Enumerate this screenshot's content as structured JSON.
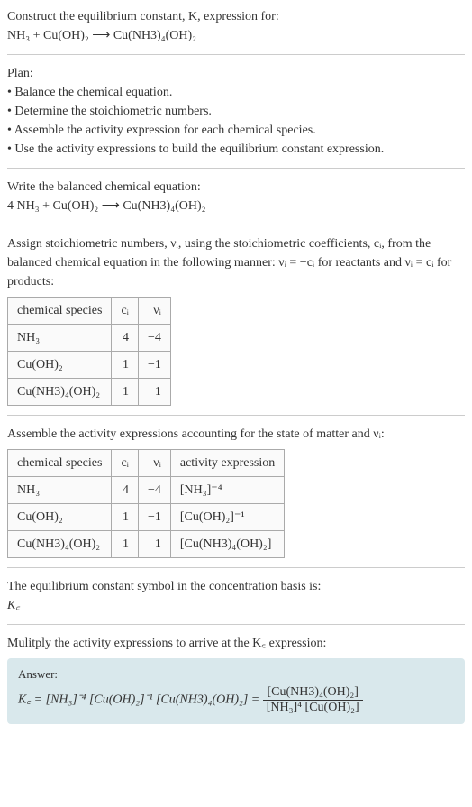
{
  "intro": {
    "line1": "Construct the equilibrium constant, K, expression for:",
    "equation": "NH₃ + Cu(OH)₂ ⟶ Cu(NH3)₄(OH)₂"
  },
  "plan": {
    "heading": "Plan:",
    "items": [
      "• Balance the chemical equation.",
      "• Determine the stoichiometric numbers.",
      "• Assemble the activity expression for each chemical species.",
      "• Use the activity expressions to build the equilibrium constant expression."
    ]
  },
  "balanced": {
    "heading": "Write the balanced chemical equation:",
    "equation": "4 NH₃ + Cu(OH)₂ ⟶ Cu(NH3)₄(OH)₂"
  },
  "assign": {
    "text": "Assign stoichiometric numbers, νᵢ, using the stoichiometric coefficients, cᵢ, from the balanced chemical equation in the following manner: νᵢ = −cᵢ for reactants and νᵢ = cᵢ for products:",
    "headers": [
      "chemical species",
      "cᵢ",
      "νᵢ"
    ],
    "rows": [
      [
        "NH₃",
        "4",
        "−4"
      ],
      [
        "Cu(OH)₂",
        "1",
        "−1"
      ],
      [
        "Cu(NH3)₄(OH)₂",
        "1",
        "1"
      ]
    ]
  },
  "activity": {
    "text": "Assemble the activity expressions accounting for the state of matter and νᵢ:",
    "headers": [
      "chemical species",
      "cᵢ",
      "νᵢ",
      "activity expression"
    ],
    "rows": [
      [
        "NH₃",
        "4",
        "−4",
        "[NH₃]⁻⁴"
      ],
      [
        "Cu(OH)₂",
        "1",
        "−1",
        "[Cu(OH)₂]⁻¹"
      ],
      [
        "Cu(NH3)₄(OH)₂",
        "1",
        "1",
        "[Cu(NH3)₄(OH)₂]"
      ]
    ]
  },
  "symbol": {
    "text": "The equilibrium constant symbol in the concentration basis is:",
    "sym": "K꜀"
  },
  "multiply": {
    "text": "Mulitply the activity expressions to arrive at the K꜀ expression:"
  },
  "answer": {
    "label": "Answer:",
    "lhs": "K꜀ = [NH₃]⁻⁴ [Cu(OH)₂]⁻¹ [Cu(NH3)₄(OH)₂] = ",
    "frac_num": "[Cu(NH3)₄(OH)₂]",
    "frac_den": "[NH₃]⁴ [Cu(OH)₂]"
  },
  "chart_data": {
    "type": "table",
    "tables": [
      {
        "title": "Stoichiometric numbers",
        "columns": [
          "chemical species",
          "c_i",
          "nu_i"
        ],
        "rows": [
          {
            "chemical species": "NH3",
            "c_i": 4,
            "nu_i": -4
          },
          {
            "chemical species": "Cu(OH)2",
            "c_i": 1,
            "nu_i": -1
          },
          {
            "chemical species": "Cu(NH3)4(OH)2",
            "c_i": 1,
            "nu_i": 1
          }
        ]
      },
      {
        "title": "Activity expressions",
        "columns": [
          "chemical species",
          "c_i",
          "nu_i",
          "activity expression"
        ],
        "rows": [
          {
            "chemical species": "NH3",
            "c_i": 4,
            "nu_i": -4,
            "activity expression": "[NH3]^-4"
          },
          {
            "chemical species": "Cu(OH)2",
            "c_i": 1,
            "nu_i": -1,
            "activity expression": "[Cu(OH)2]^-1"
          },
          {
            "chemical species": "Cu(NH3)4(OH)2",
            "c_i": 1,
            "nu_i": 1,
            "activity expression": "[Cu(NH3)4(OH)2]"
          }
        ]
      }
    ]
  }
}
